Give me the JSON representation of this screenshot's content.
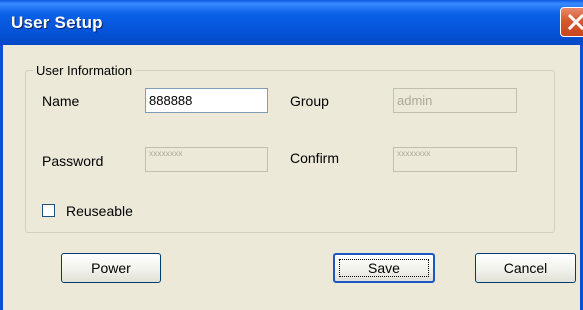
{
  "window": {
    "title": "User Setup",
    "close_icon": "close-icon"
  },
  "group": {
    "legend": "User Information",
    "name_label": "Name",
    "name_value": "888888",
    "group_label": "Group",
    "group_value": "admin",
    "password_label": "Password",
    "password_mask": "xxxxxxxx",
    "confirm_label": "Confirm",
    "confirm_mask": "xxxxxxxx",
    "reuseable_label": "Reuseable",
    "reuseable_checked": false
  },
  "buttons": {
    "power": "Power",
    "save": "Save",
    "cancel": "Cancel"
  },
  "colors": {
    "titlebar": "#0453D9",
    "dialog_bg": "#ECE9D8",
    "close_button": "#D7572F"
  }
}
